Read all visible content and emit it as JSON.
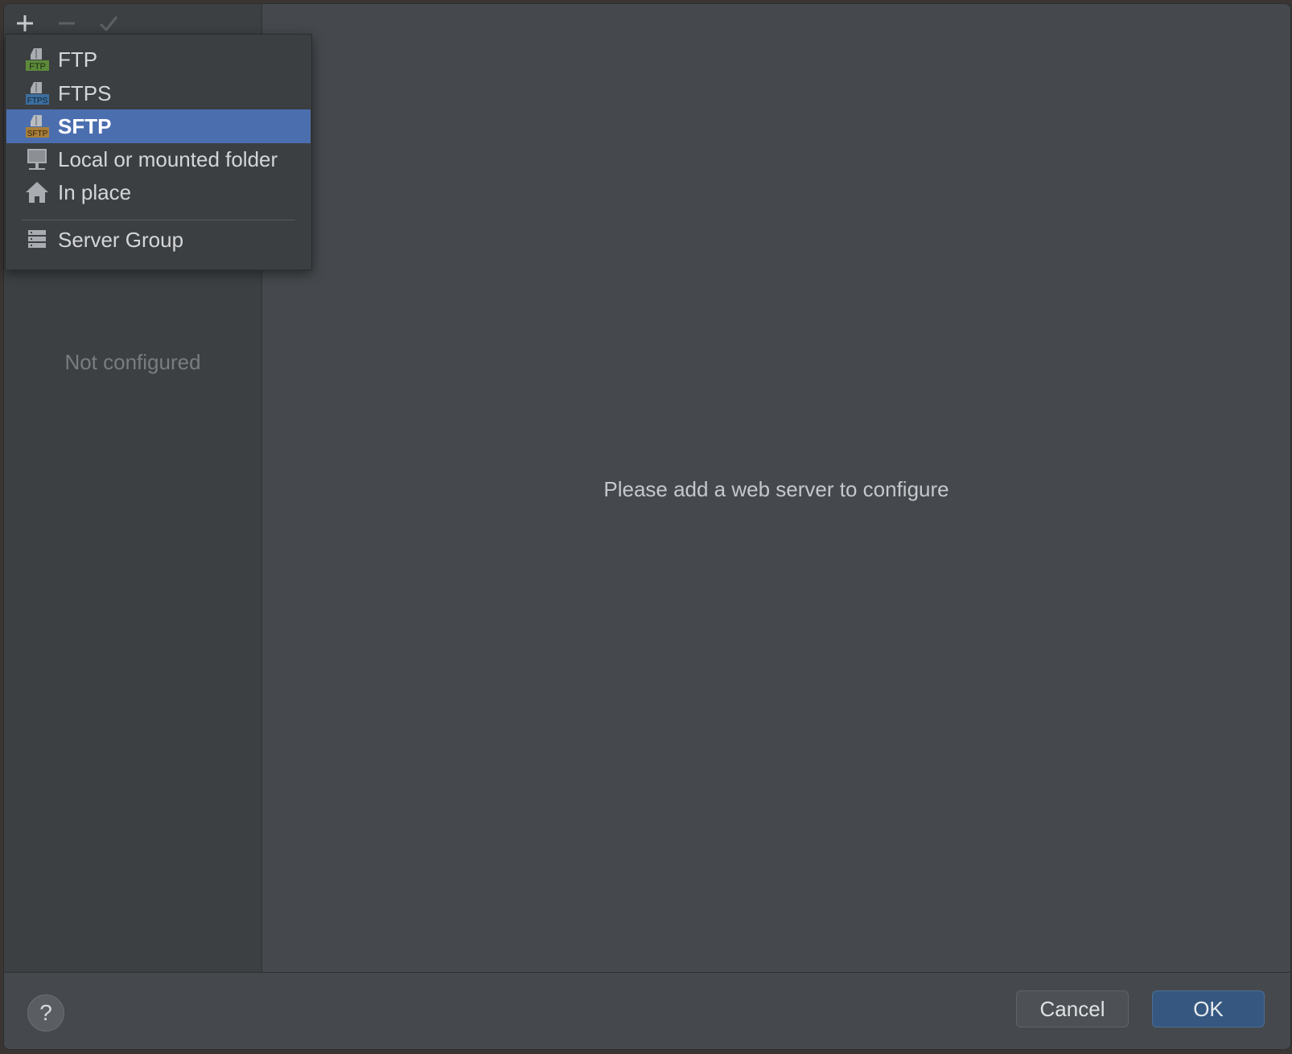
{
  "toolbar": {
    "add_icon": "plus-icon",
    "remove_icon": "minus-icon",
    "apply_icon": "check-icon"
  },
  "left_panel": {
    "empty_text": "Not configured"
  },
  "main": {
    "placeholder": "Please add a web server to configure"
  },
  "popup": {
    "items": [
      {
        "label": "FTP",
        "icon": "ftp-icon",
        "badge": "FTP"
      },
      {
        "label": "FTPS",
        "icon": "ftps-icon",
        "badge": "FTPS"
      },
      {
        "label": "SFTP",
        "icon": "sftp-icon",
        "badge": "SFTP",
        "selected": true
      },
      {
        "label": "Local or mounted folder",
        "icon": "folder-computer-icon"
      },
      {
        "label": "In place",
        "icon": "home-icon"
      },
      {
        "label": "Server Group",
        "icon": "server-group-icon"
      }
    ]
  },
  "footer": {
    "help": "?",
    "cancel": "Cancel",
    "ok": "OK"
  },
  "colors": {
    "selection": "#4b6eaf",
    "ok_button": "#365880",
    "ftp_green": "#5c8a3a",
    "ftps_blue": "#3d6f9e",
    "sftp_orange": "#a87f3a"
  }
}
